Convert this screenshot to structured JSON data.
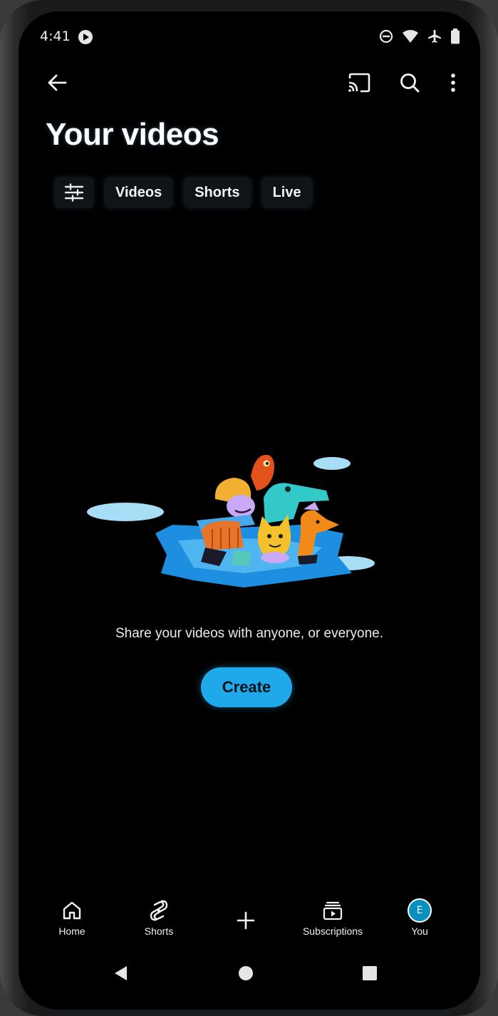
{
  "status_bar": {
    "time": "4:41",
    "icons": [
      "youtube-notification-icon",
      "do-not-disturb-icon",
      "wifi-icon",
      "airplane-mode-icon",
      "battery-icon"
    ]
  },
  "app_bar": {
    "icons": [
      "back-arrow-icon",
      "cast-icon",
      "search-icon",
      "more-vert-icon"
    ]
  },
  "page": {
    "title": "Your videos"
  },
  "filter_chips": [
    {
      "label": "Videos"
    },
    {
      "label": "Shorts"
    },
    {
      "label": "Live"
    }
  ],
  "empty_state": {
    "message": "Share your videos with anyone, or everyone.",
    "button_label": "Create"
  },
  "bottom_nav": {
    "items": [
      {
        "label": "Home",
        "icon": "home-icon"
      },
      {
        "label": "Shorts",
        "icon": "shorts-icon"
      },
      {
        "label": "",
        "icon": "plus-icon"
      },
      {
        "label": "Subscriptions",
        "icon": "subscriptions-icon"
      },
      {
        "label": "You",
        "icon": "avatar-icon"
      }
    ],
    "avatar_initial": "E"
  },
  "colors": {
    "accent": "#1fa9ea",
    "background": "#000000",
    "chip_background": "#0e1418"
  }
}
